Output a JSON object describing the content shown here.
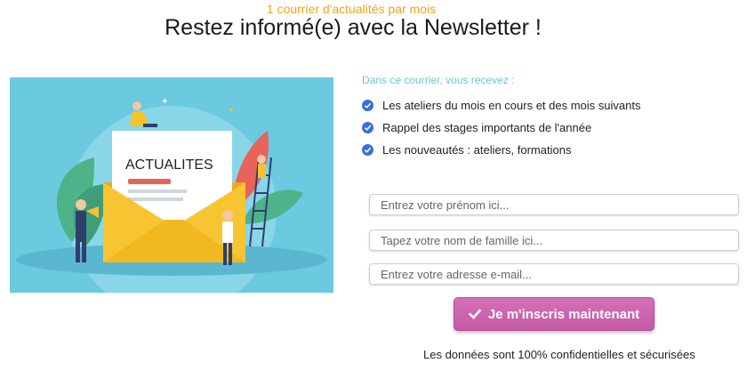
{
  "header": {
    "kicker": "1 courrier d'actualités par mois",
    "title": "Restez informé(e) avec la Newsletter !"
  },
  "illustration": {
    "envelope_label": "ACTUALITES",
    "colors": {
      "sky": "#6bc9e0",
      "envelope": "#f7c531",
      "leaf_red": "#e8635a",
      "leaf_green": "#4fb38a"
    }
  },
  "benefits": {
    "intro": "Dans ce courrier, vous recevez :",
    "items": [
      "Les ateliers du mois en cours et des mois suivants",
      "Rappel des stages importants de l'année",
      "Les nouveautés : ateliers, formations"
    ],
    "check_color": "#3a6fd8"
  },
  "form": {
    "first_name_placeholder": "Entrez votre prénom ici...",
    "last_name_placeholder": "Tapez votre nom de famille ici...",
    "email_placeholder": "Entrez votre adresse e-mail...",
    "submit_label": "Je m'inscris maintenant",
    "submit_color": "#c862ad",
    "privacy_note": "Les données sont 100% confidentielles et sécurisées"
  }
}
